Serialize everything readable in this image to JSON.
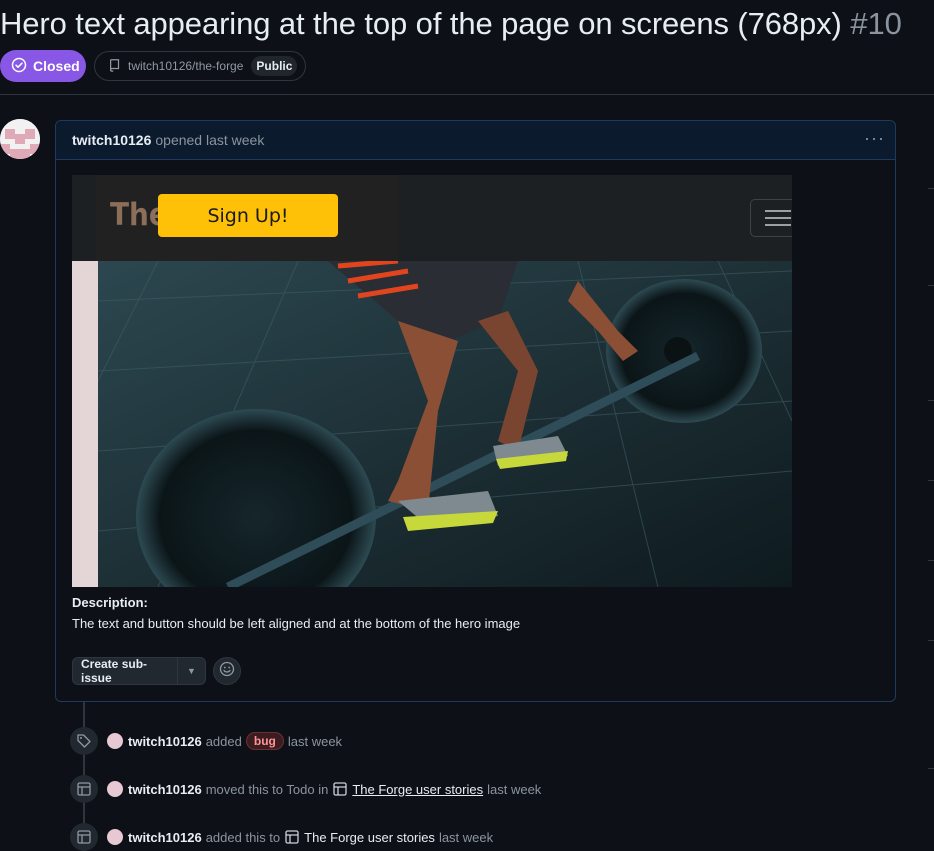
{
  "issue": {
    "title": "Hero text appearing at the top of the page on screens (768px)",
    "number": "#10",
    "state": "Closed",
    "repo": "twitch10126/the-forge",
    "visibility": "Public"
  },
  "comment": {
    "author": "twitch10126",
    "meta": "opened last week",
    "screenshot": {
      "logo_text": "The",
      "signup_label": "Sign Up!"
    },
    "description_label": "Description:",
    "description_text": "The text and button should be left aligned and at the bottom of the hero image",
    "create_subissue_label": "Create sub-issue"
  },
  "timeline": [
    {
      "icon": "tag-icon",
      "author": "twitch10126",
      "action": "added",
      "label": "bug",
      "time": "last week"
    },
    {
      "icon": "project-icon",
      "author": "twitch10126",
      "action": "moved this to Todo in",
      "project": "The Forge user stories",
      "time": "last week"
    },
    {
      "icon": "project-icon",
      "author": "twitch10126",
      "action": "added this to",
      "project": "The Forge user stories",
      "time": "last week"
    }
  ],
  "colors": {
    "background": "#0d1117",
    "closed_badge": "#8957e5",
    "signup_button": "#ffc107",
    "bug_label": "#ff9492"
  }
}
